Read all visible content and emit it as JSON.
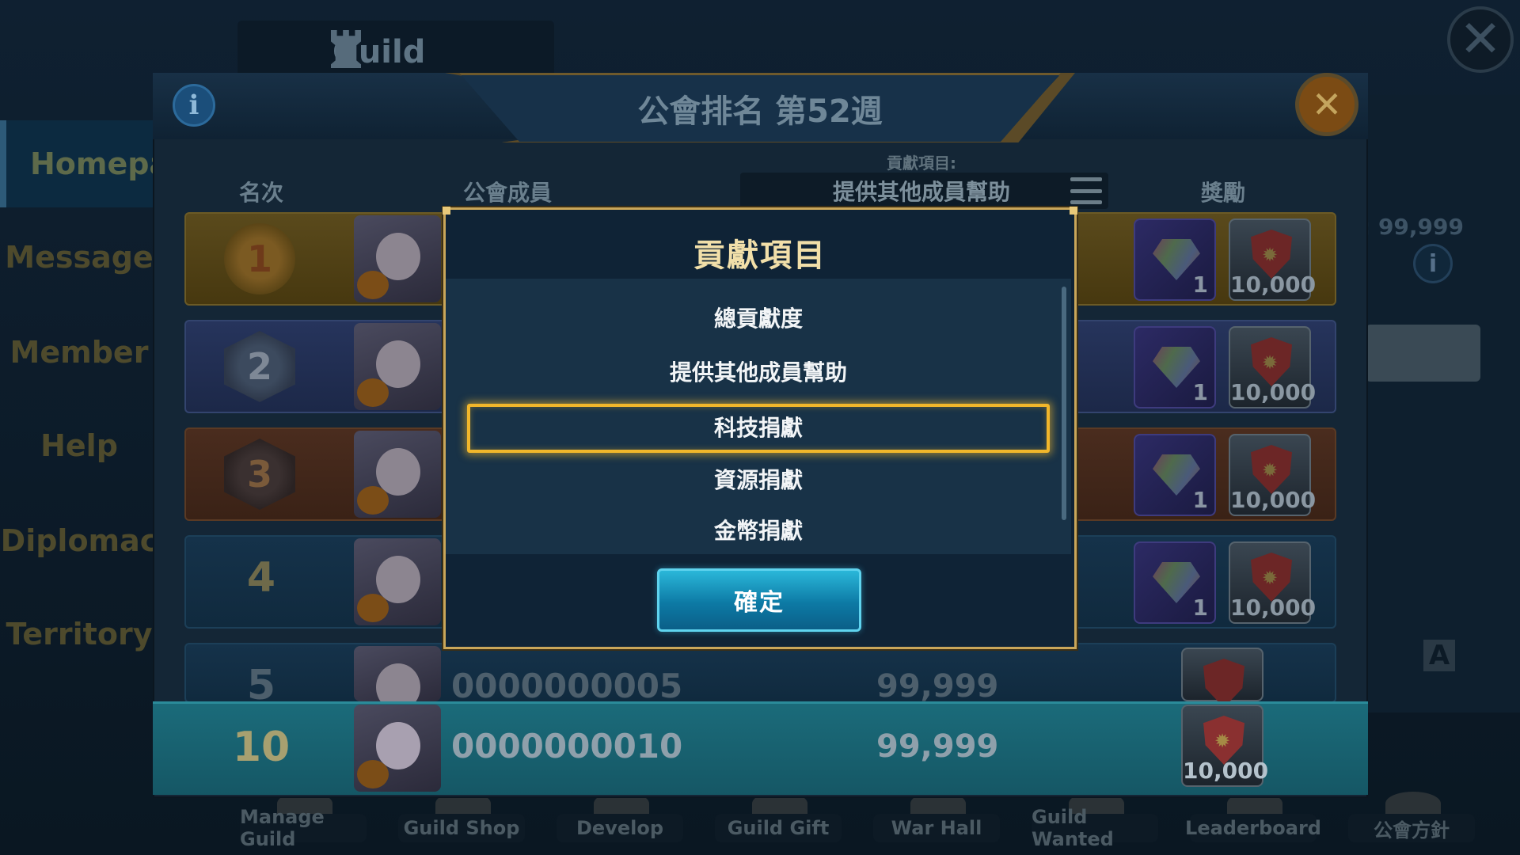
{
  "background": {
    "guild_tab_label": "Guild",
    "side_menu": [
      "Homepag",
      "Message",
      "Member",
      "Help",
      "Diplomac",
      "Territory"
    ],
    "right_panel_value": ": 99,999",
    "letter_icon": "A",
    "bottom_buttons": [
      "Manage Guild",
      "Guild Shop",
      "Develop",
      "Guild Gift",
      "War Hall",
      "Guild Wanted",
      "Leaderboard",
      "公會方針"
    ]
  },
  "ranking": {
    "title": "公會排名 第52週",
    "info_icon": "i",
    "close_icon": "✕",
    "columns": {
      "rank": "名次",
      "member": "公會成員",
      "reward": "獎勵"
    },
    "contribution_label": "貢獻項目:",
    "contribution_selected": "提供其他成員幫助",
    "rows": [
      {
        "rank": "1",
        "gem_count": "1",
        "shield_count": "10,000"
      },
      {
        "rank": "2",
        "gem_count": "1",
        "shield_count": "10,000"
      },
      {
        "rank": "3",
        "gem_count": "1",
        "shield_count": "10,000"
      },
      {
        "rank": "4",
        "gem_count": "1",
        "shield_count": "10,000"
      },
      {
        "rank": "5",
        "name": "0000000005",
        "score": "99,999"
      }
    ],
    "self_row": {
      "rank": "10",
      "name": "0000000010",
      "score": "99,999",
      "shield_count": "10,000"
    }
  },
  "modal": {
    "title": "貢獻項目",
    "options": [
      "總貢獻度",
      "提供其他成員幫助",
      "科技捐獻",
      "資源捐獻",
      "金幣捐獻"
    ],
    "selected_index": 2,
    "confirm_label": "確定"
  },
  "colors": {
    "modal_border": "#c9a65a",
    "selection_glow": "#f1b62b",
    "confirm_button": "#1a9cc8"
  }
}
